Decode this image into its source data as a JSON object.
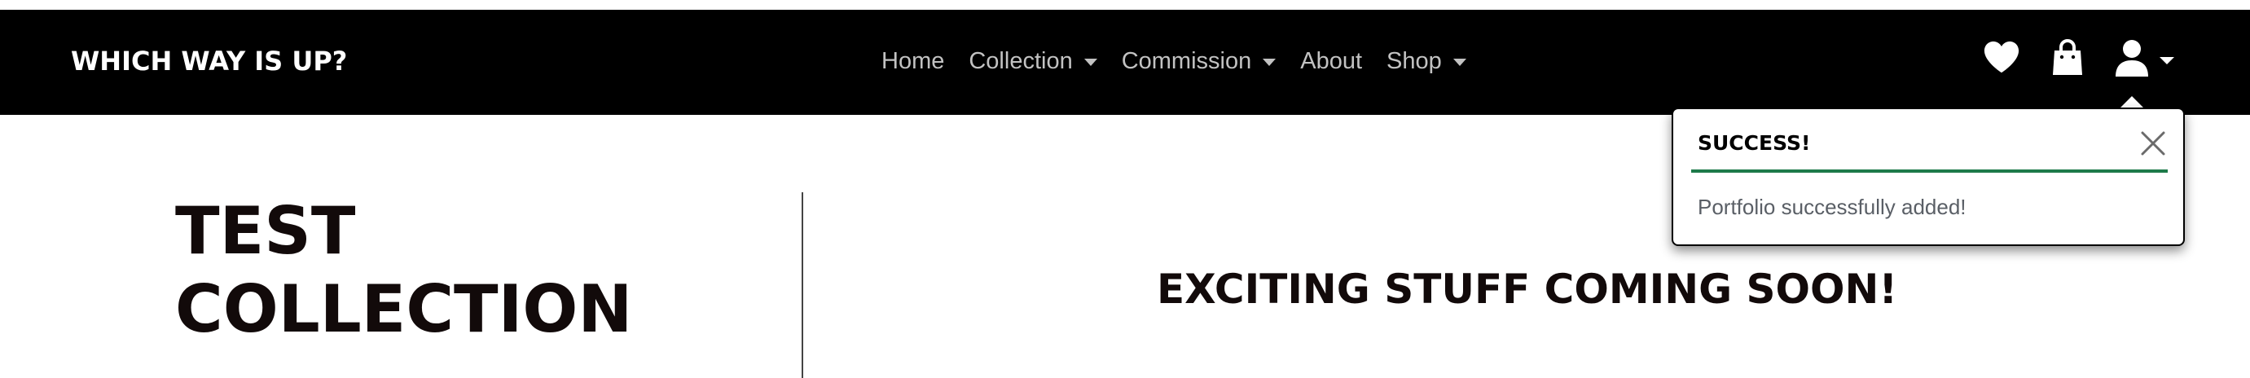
{
  "brand": {
    "name": "WHICH WAY IS UP?"
  },
  "nav": {
    "items": [
      {
        "label": "Home",
        "dropdown": false
      },
      {
        "label": "Collection",
        "dropdown": true
      },
      {
        "label": "Commission",
        "dropdown": true
      },
      {
        "label": "About",
        "dropdown": false
      },
      {
        "label": "Shop",
        "dropdown": true
      }
    ]
  },
  "icons": {
    "wishlist": "heart-icon",
    "cart": "shopping-bag-icon",
    "account": "user-icon"
  },
  "toast": {
    "title": "SUCCESS!",
    "message": "Portfolio successfully added!",
    "accent_color": "#1d7a4a"
  },
  "main": {
    "title": "TEST COLLECTION",
    "placeholder_text": "EXCITING STUFF COMING SOON!"
  },
  "colors": {
    "navbar_bg": "#000000",
    "nav_text": "#c2c2c2",
    "heading_text": "#120a0a"
  }
}
